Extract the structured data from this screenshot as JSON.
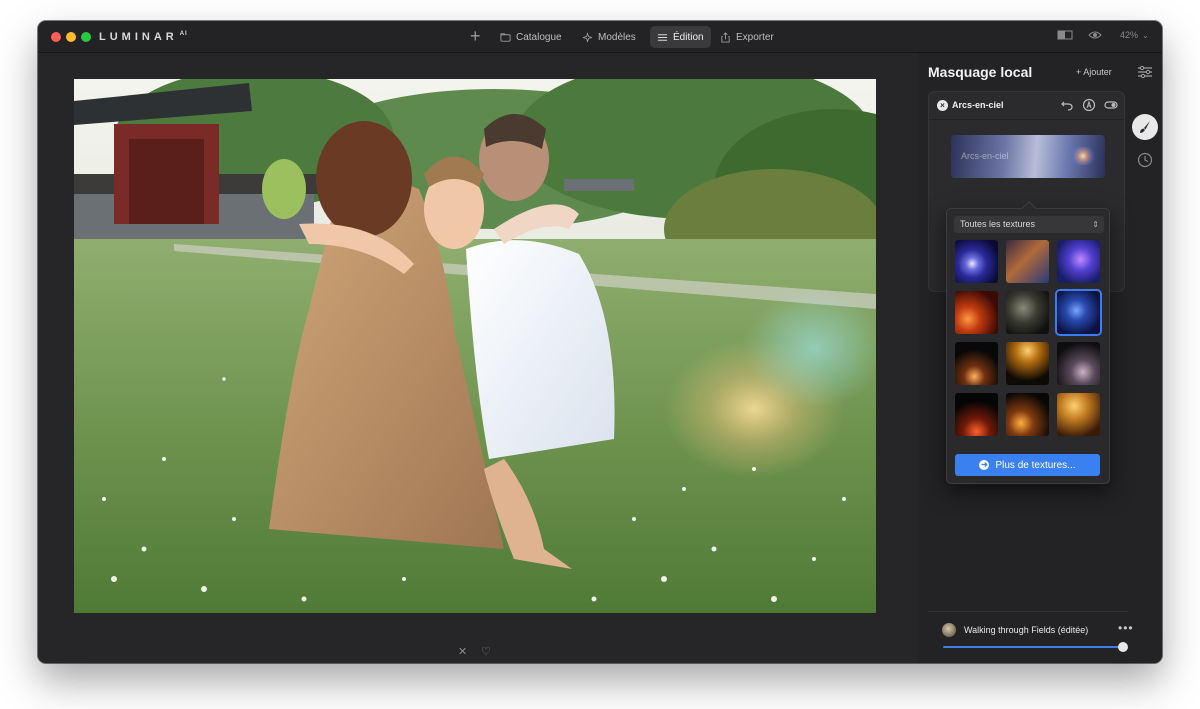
{
  "app": {
    "logo_text": "LUMINAR",
    "logo_super": "AI"
  },
  "nav": {
    "items": [
      {
        "label": "Catalogue",
        "icon": "folder-icon",
        "active": false
      },
      {
        "label": "Modèles",
        "icon": "sparkle-icon",
        "active": false
      },
      {
        "label": "Édition",
        "icon": "sliders-icon",
        "active": true
      },
      {
        "label": "Exporter",
        "icon": "share-icon",
        "active": false
      }
    ],
    "zoom": "42%"
  },
  "panel": {
    "title": "Masquage local",
    "add_label": "+ Ajouter",
    "layer": {
      "name": "Arcs-en-ciel",
      "texture_label": "Arcs-en-ciel"
    }
  },
  "texture_picker": {
    "filter": "Toutes les textures",
    "selected_index": 5,
    "more_label": "Plus de textures...",
    "tiles": [
      {
        "name": "texture-blue-bokeh"
      },
      {
        "name": "texture-amber-blue-haze"
      },
      {
        "name": "texture-purple-glow"
      },
      {
        "name": "texture-red-orange-flare"
      },
      {
        "name": "texture-dark-smoke"
      },
      {
        "name": "texture-blue-sparkle"
      },
      {
        "name": "texture-warm-lights-low"
      },
      {
        "name": "texture-golden-bokeh-top"
      },
      {
        "name": "texture-pink-dust"
      },
      {
        "name": "texture-red-bottom-flare"
      },
      {
        "name": "texture-amber-bokeh-dots"
      },
      {
        "name": "texture-golden-amber-bokeh"
      }
    ]
  },
  "footer": {
    "file_name": "Walking through Fields (éditée)",
    "menu_label": "•••"
  },
  "colors": {
    "accent": "#3a80f0",
    "window_bg": "#1e1e20",
    "panel_bg": "#232325"
  }
}
